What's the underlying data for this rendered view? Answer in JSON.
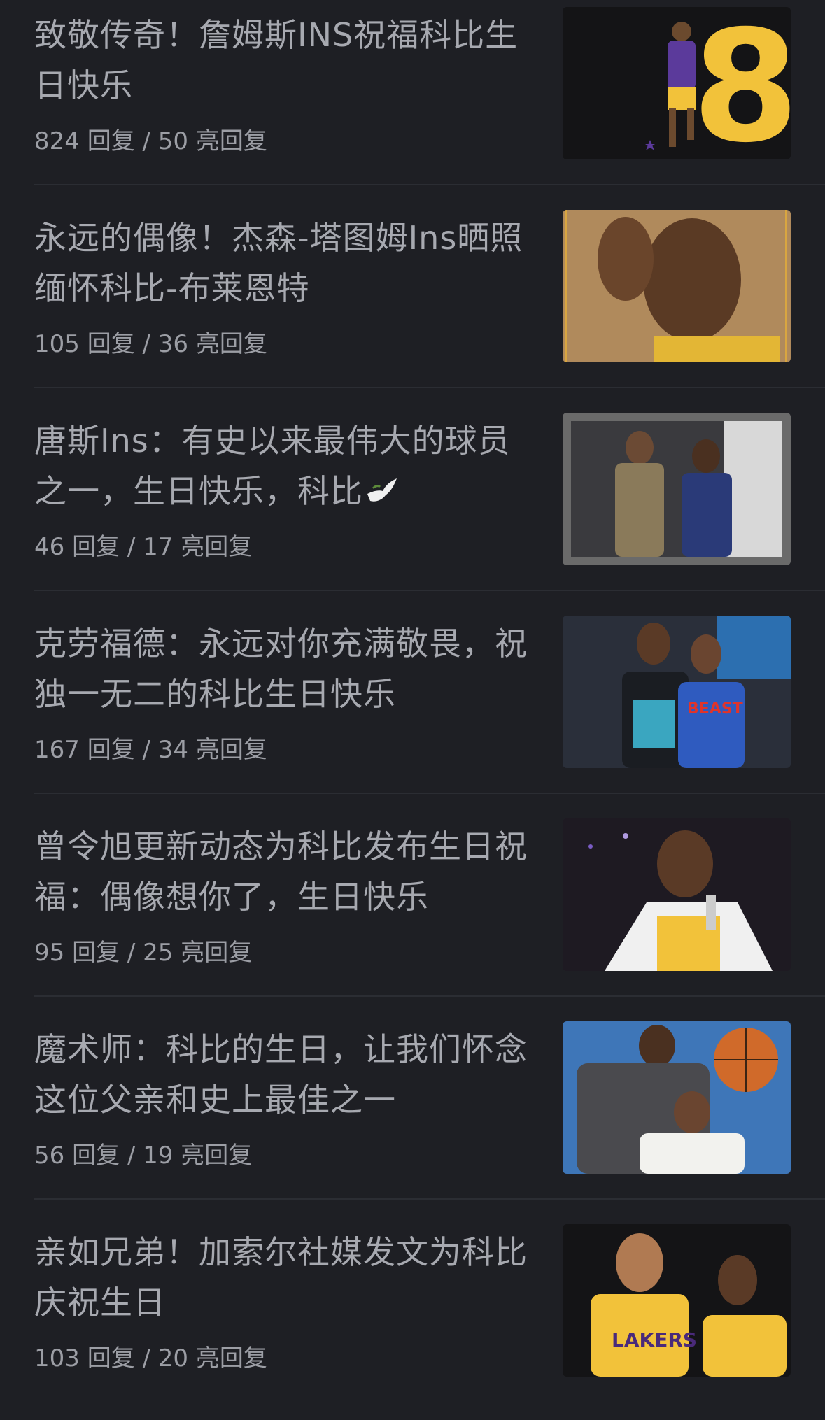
{
  "feed": {
    "items": [
      {
        "title": "致敬传奇！詹姆斯INS祝福科比生日快乐",
        "meta": "824 回复 / 50 亮回复",
        "thumb_icon": "kobe-number-8-image"
      },
      {
        "title": "永远的偶像！杰森-塔图姆Ins晒照缅怀科比-布莱恩特",
        "meta": "105 回复 / 36 亮回复",
        "thumb_icon": "kobe-portrait-image"
      },
      {
        "title": "唐斯Ins：有史以来最伟大的球员之一，生日快乐，科比",
        "meta": "46 回复 / 17 亮回复",
        "thumb_icon": "towns-and-kobe-photo",
        "emoji": "dove-icon"
      },
      {
        "title": "克劳福德：永远对你充满敬畏，祝独一无二的科比生日快乐",
        "meta": "167 回复 / 34 亮回复",
        "thumb_icon": "kobe-and-crawford-photo"
      },
      {
        "title": "曾令旭更新动态为科比发布生日祝福：偶像想你了，生日快乐",
        "meta": "95 回复 / 25 亮回复",
        "thumb_icon": "kobe-speech-photo"
      },
      {
        "title": "魔术师：科比的生日，让我们怀念这位父亲和史上最佳之一",
        "meta": "56 回复 / 19 亮回复",
        "thumb_icon": "magic-and-kobe-photo"
      },
      {
        "title": "亲如兄弟！加索尔社媒发文为科比庆祝生日",
        "meta": "103 回复 / 20 亮回复",
        "thumb_icon": "gasol-and-kobe-photo"
      }
    ]
  },
  "colors": {
    "background": "#1e1f24",
    "title_text": "#a7a9b0",
    "meta_text": "#9c9ea5",
    "divider": "#2b2d33"
  }
}
